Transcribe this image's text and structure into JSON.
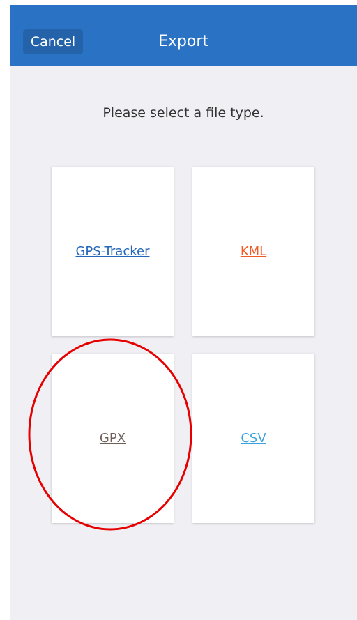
{
  "navbar": {
    "cancel_label": "Cancel",
    "title": "Export"
  },
  "main": {
    "prompt": "Please select a file type.",
    "file_types": [
      {
        "label": "GPS-Tracker",
        "color": "#2466b8"
      },
      {
        "label": "KML",
        "color": "#f05a24"
      },
      {
        "label": "GPX",
        "color": "#6e5f58"
      },
      {
        "label": "CSV",
        "color": "#3aa3dd"
      }
    ]
  },
  "annotation": {
    "type": "circle",
    "color": "#e60000"
  }
}
